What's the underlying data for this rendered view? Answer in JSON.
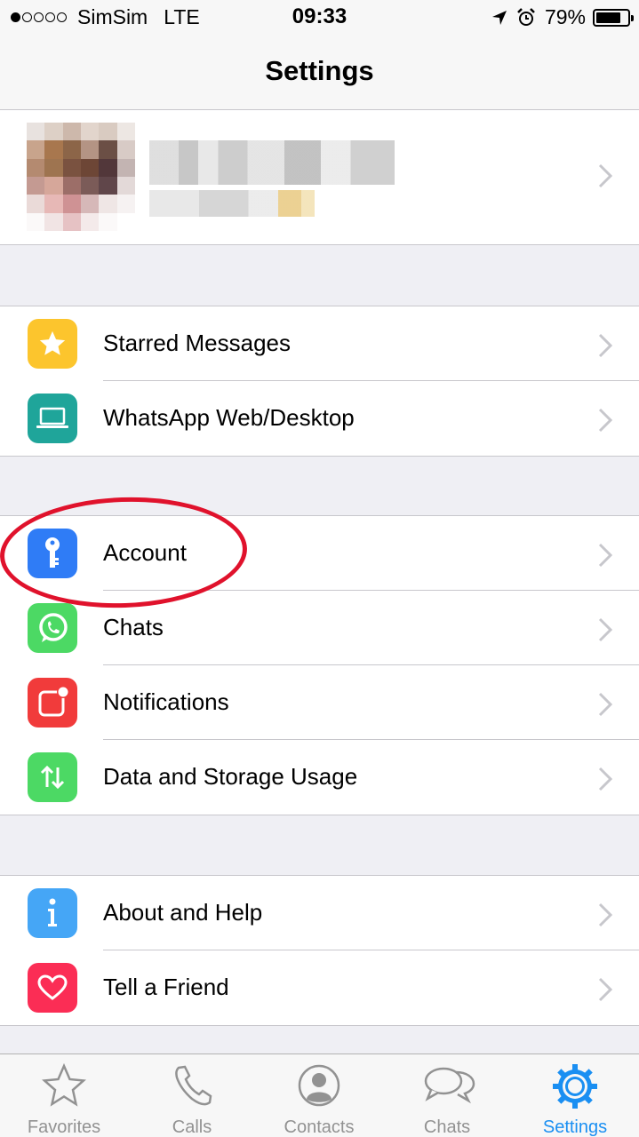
{
  "status_bar": {
    "carrier": "SimSim",
    "network": "LTE",
    "time": "09:33",
    "battery": "79%",
    "battery_level": 0.79
  },
  "nav": {
    "title": "Settings"
  },
  "groups": [
    {
      "items": [
        {
          "label": "Starred Messages",
          "icon": "star-icon",
          "color": "#fcc52d"
        },
        {
          "label": "WhatsApp Web/Desktop",
          "icon": "laptop-icon",
          "color": "#1fa59a"
        }
      ]
    },
    {
      "items": [
        {
          "label": "Account",
          "icon": "key-icon",
          "color": "#2f7cf6"
        },
        {
          "label": "Chats",
          "icon": "whatsapp-icon",
          "color": "#4cd964"
        },
        {
          "label": "Notifications",
          "icon": "notification-icon",
          "color": "#f13b3b"
        },
        {
          "label": "Data and Storage Usage",
          "icon": "arrows-icon",
          "color": "#4cd964"
        }
      ]
    },
    {
      "items": [
        {
          "label": "About and Help",
          "icon": "info-icon",
          "color": "#45a6f6"
        },
        {
          "label": "Tell a Friend",
          "icon": "heart-icon",
          "color": "#fb2d55"
        }
      ]
    }
  ],
  "tabs": [
    {
      "label": "Favorites",
      "icon": "star-outline-icon"
    },
    {
      "label": "Calls",
      "icon": "phone-icon"
    },
    {
      "label": "Contacts",
      "icon": "contact-icon"
    },
    {
      "label": "Chats",
      "icon": "chat-bubbles-icon"
    },
    {
      "label": "Settings",
      "icon": "gear-icon",
      "active": true
    }
  ],
  "colors": {
    "accent": "#1a8ff2",
    "annotation": "#e0122c",
    "background": "#efeff4"
  }
}
